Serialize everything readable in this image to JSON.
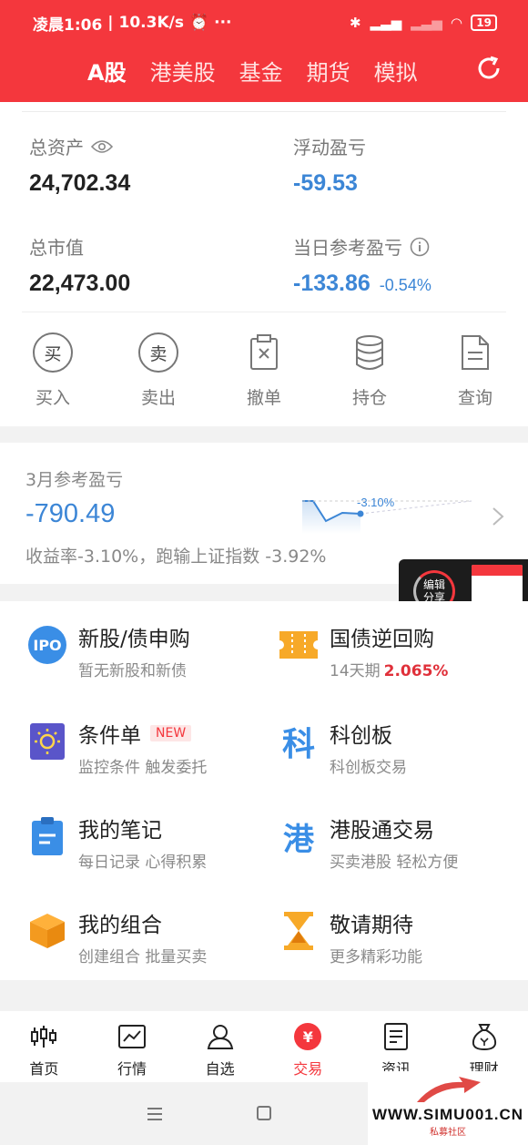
{
  "status_bar": {
    "time": "凌晨1:06",
    "speed": "10.3K/s",
    "dots": "···",
    "battery": "19"
  },
  "header": {
    "tabs": [
      {
        "label": "A股",
        "active": true
      },
      {
        "label": "港美股",
        "active": false
      },
      {
        "label": "基金",
        "active": false
      },
      {
        "label": "期货",
        "active": false
      },
      {
        "label": "模拟",
        "active": false
      }
    ],
    "accent": "#f4373d"
  },
  "account": {
    "total_assets": {
      "label": "总资产",
      "value": "24,702.34"
    },
    "floating_pl": {
      "label": "浮动盈亏",
      "value": "-59.53"
    },
    "market_value": {
      "label": "总市值",
      "value": "22,473.00"
    },
    "daily_pl": {
      "label": "当日参考盈亏",
      "value": "-133.86",
      "pct": "-0.54%"
    }
  },
  "actions": [
    {
      "label": "买入",
      "glyph": "买",
      "icon": "buy-icon"
    },
    {
      "label": "卖出",
      "glyph": "卖",
      "icon": "sell-icon"
    },
    {
      "label": "撤单",
      "icon": "cancel-order-icon"
    },
    {
      "label": "持仓",
      "icon": "positions-icon"
    },
    {
      "label": "查询",
      "icon": "query-document-icon"
    }
  ],
  "monthly": {
    "title": "3月参考盈亏",
    "value": "-790.49",
    "desc": "收益率-3.10%，跑输上证指数 -3.92%",
    "spark_label": "-3.10%"
  },
  "share_float": {
    "label_line1": "编辑",
    "label_line2": "分享"
  },
  "features": [
    {
      "name": "新股/债申购",
      "sub": "暂无新股和新债",
      "icon": "ipo-icon",
      "icon_text": "IPO"
    },
    {
      "name": "国债逆回购",
      "sub": "14天期",
      "rate": "2.065%",
      "icon": "ticket-icon"
    },
    {
      "name": "条件单",
      "tag": "NEW",
      "sub": "监控条件 触发委托",
      "icon": "bulb-icon"
    },
    {
      "name": "科创板",
      "sub": "科创板交易",
      "icon": "star-market-icon",
      "icon_text": "科"
    },
    {
      "name": "我的笔记",
      "sub": "每日记录 心得积累",
      "icon": "notes-clipboard-icon"
    },
    {
      "name": "港股通交易",
      "sub": "买卖港股 轻松方便",
      "icon": "hk-connect-icon",
      "icon_text": "港"
    },
    {
      "name": "我的组合",
      "sub": "创建组合 批量买卖",
      "icon": "box-icon"
    },
    {
      "name": "敬请期待",
      "sub": "更多精彩功能",
      "icon": "hourglass-icon"
    }
  ],
  "bottom_nav": [
    {
      "label": "首页",
      "icon": "candlestick-icon"
    },
    {
      "label": "行情",
      "icon": "chart-line-icon"
    },
    {
      "label": "自选",
      "icon": "user-icon"
    },
    {
      "label": "交易",
      "icon": "yen-icon",
      "active": true
    },
    {
      "label": "资讯",
      "icon": "news-icon"
    },
    {
      "label": "理财",
      "icon": "money-bag-icon"
    }
  ],
  "watermark": {
    "text": "WWW.SIMU001.CN",
    "sub": "私募社区"
  }
}
